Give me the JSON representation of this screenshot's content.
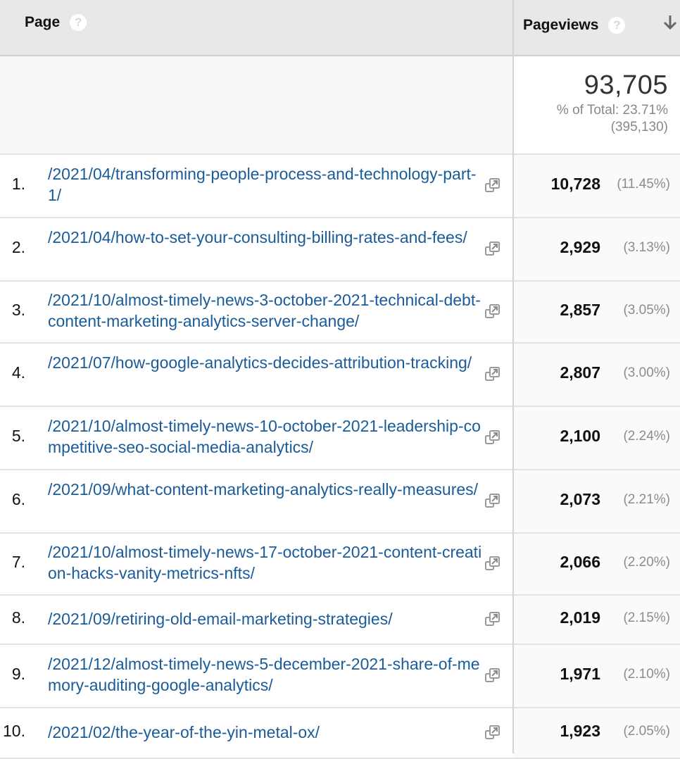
{
  "header": {
    "page_label": "Page",
    "pageviews_label": "Pageviews",
    "help_glyph": "?",
    "sort_icon": "arrow-down-icon"
  },
  "summary": {
    "total_value": "93,705",
    "percent_of_total": "% of Total: 23.71%",
    "site_total": "(395,130)"
  },
  "colors": {
    "link": "#1a5b99",
    "header_bg": "#e8e8e8",
    "muted_text": "#888888"
  },
  "rows": [
    {
      "rank": "1.",
      "page": "/2021/04/transforming-people-process-and-technology-part-1/",
      "pageviews": "10,728",
      "percent": "(11.45%)"
    },
    {
      "rank": "2.",
      "page": "/2021/04/how-to-set-your-consulting-billing-rates-and-fees/",
      "pageviews": "2,929",
      "percent": "(3.13%)"
    },
    {
      "rank": "3.",
      "page": "/2021/10/almost-timely-news-3-october-2021-technical-debt-content-marketing-analytics-server-change/",
      "pageviews": "2,857",
      "percent": "(3.05%)"
    },
    {
      "rank": "4.",
      "page": "/2021/07/how-google-analytics-decides-attribution-tracking/",
      "pageviews": "2,807",
      "percent": "(3.00%)"
    },
    {
      "rank": "5.",
      "page": "/2021/10/almost-timely-news-10-october-2021-leadership-competitive-seo-social-media-analytics/",
      "pageviews": "2,100",
      "percent": "(2.24%)"
    },
    {
      "rank": "6.",
      "page": "/2021/09/what-content-marketing-analytics-really-measures/",
      "pageviews": "2,073",
      "percent": "(2.21%)"
    },
    {
      "rank": "7.",
      "page": "/2021/10/almost-timely-news-17-october-2021-content-creation-hacks-vanity-metrics-nfts/",
      "pageviews": "2,066",
      "percent": "(2.20%)"
    },
    {
      "rank": "8.",
      "page": "/2021/09/retiring-old-email-marketing-strategies/",
      "pageviews": "2,019",
      "percent": "(2.15%)"
    },
    {
      "rank": "9.",
      "page": "/2021/12/almost-timely-news-5-december-2021-share-of-memory-auditing-google-analytics/",
      "pageviews": "1,971",
      "percent": "(2.10%)"
    },
    {
      "rank": "10.",
      "page": "/2021/02/the-year-of-the-yin-metal-ox/",
      "pageviews": "1,923",
      "percent": "(2.05%)"
    }
  ]
}
